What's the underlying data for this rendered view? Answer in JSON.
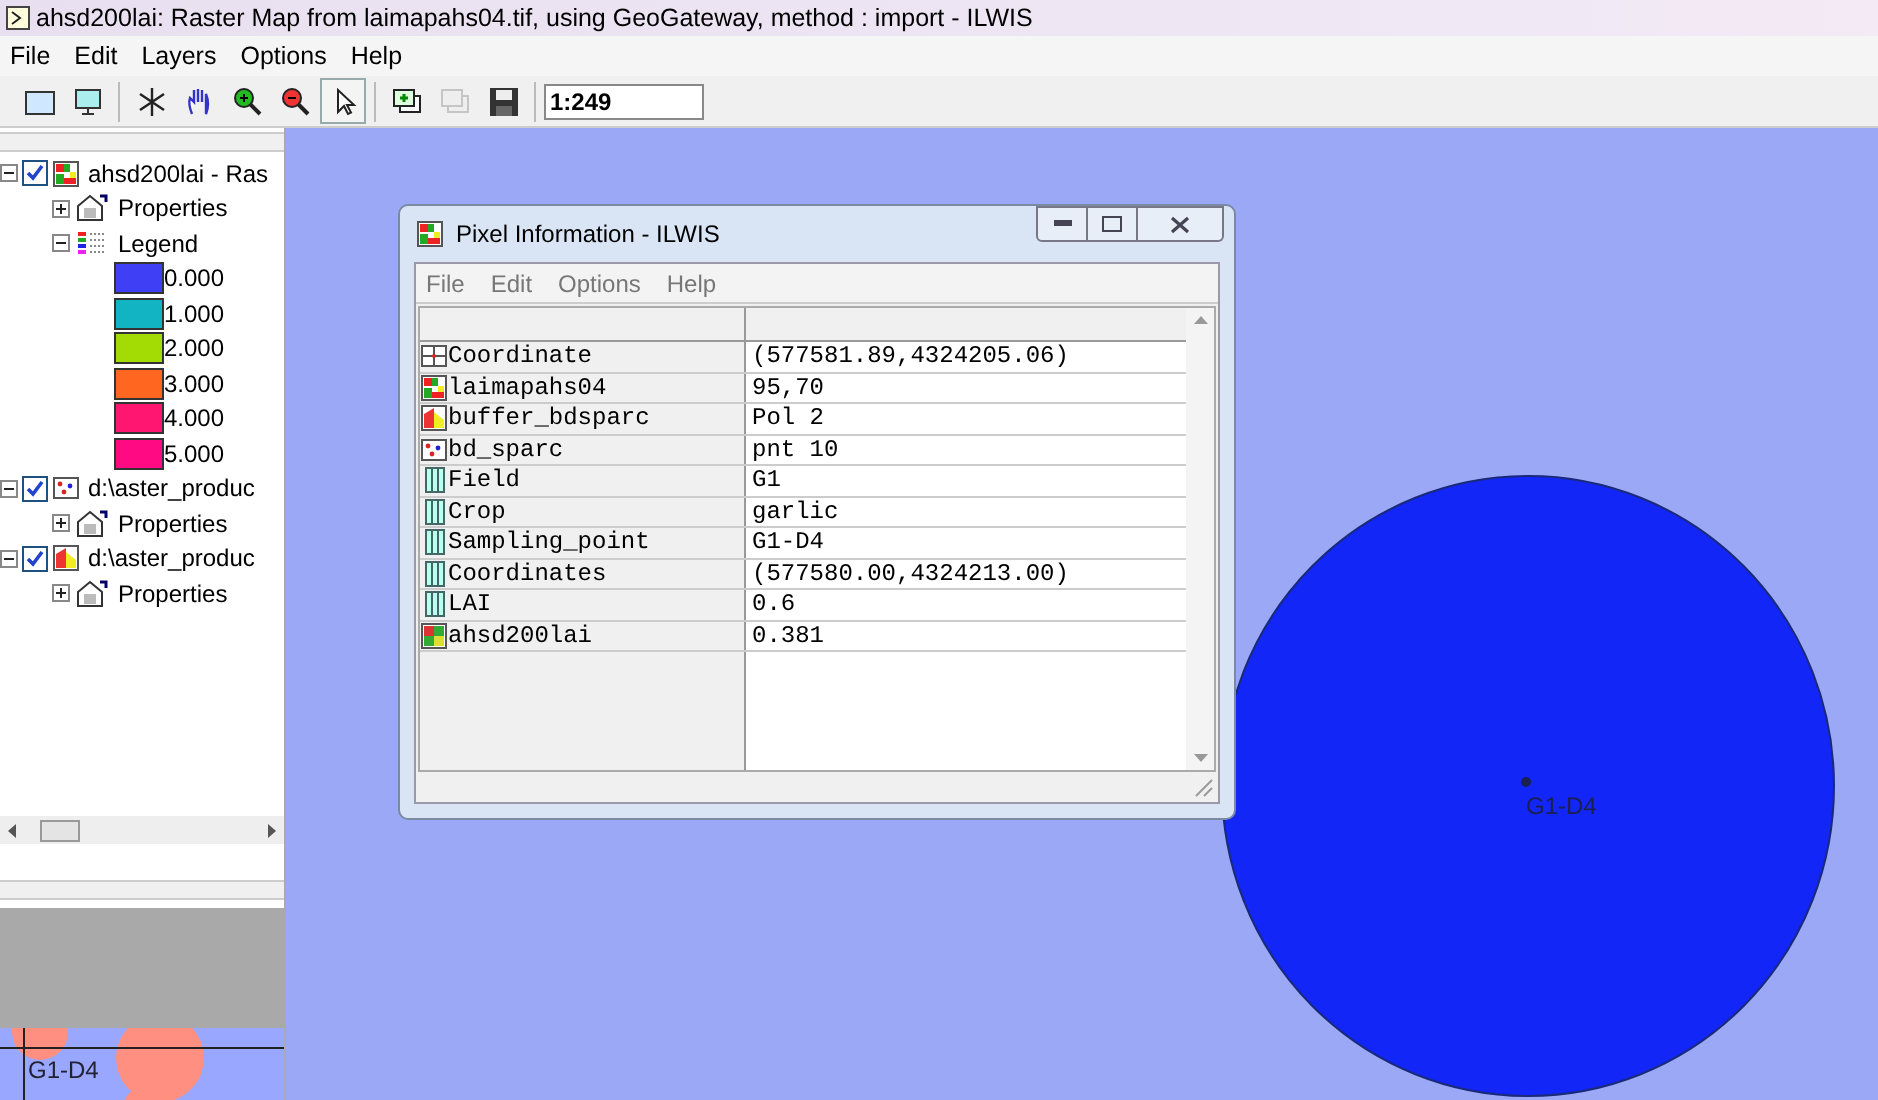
{
  "window": {
    "title": "ahsd200lai: Raster Map from laimapahs04.tif, using GeoGateway, method : import - ILWIS"
  },
  "menu": [
    "File",
    "Edit",
    "Layers",
    "Options",
    "Help"
  ],
  "toolbar": {
    "buttons": [
      {
        "kind": "new-map",
        "selected": false,
        "disabled": false
      },
      {
        "kind": "screen",
        "selected": false,
        "disabled": false
      },
      {
        "kind": "sep"
      },
      {
        "kind": "star",
        "selected": false,
        "disabled": false
      },
      {
        "kind": "hand",
        "selected": false,
        "disabled": false
      },
      {
        "kind": "zoom-in",
        "selected": false,
        "disabled": false
      },
      {
        "kind": "zoom-out",
        "selected": false,
        "disabled": false
      },
      {
        "kind": "pointer",
        "selected": true,
        "disabled": false
      },
      {
        "kind": "sep"
      },
      {
        "kind": "add-layer",
        "selected": false,
        "disabled": false
      },
      {
        "kind": "remove-layer",
        "selected": false,
        "disabled": true
      },
      {
        "kind": "save",
        "selected": false,
        "disabled": false
      }
    ],
    "scale": "1:249"
  },
  "layers": [
    {
      "name": "ahsd200lai - Ras",
      "kind": "raster",
      "checked": true,
      "expanded": true,
      "properties": "Properties",
      "legend": {
        "label": "Legend",
        "expanded": true,
        "entries": [
          {
            "value": "0.000",
            "color": "#3f3ff5"
          },
          {
            "value": "1.000",
            "color": "#12b3c3"
          },
          {
            "value": "2.000",
            "color": "#a3dc04"
          },
          {
            "value": "3.000",
            "color": "#ff6620"
          },
          {
            "value": "4.000",
            "color": "#ff1670"
          },
          {
            "value": "5.000",
            "color": "#ff0a82"
          }
        ]
      }
    },
    {
      "name": "d:\\aster_produc",
      "kind": "point",
      "checked": true,
      "expanded": true,
      "properties": "Properties"
    },
    {
      "name": "d:\\aster_produc",
      "kind": "polygon",
      "checked": true,
      "expanded": true,
      "properties": "Properties"
    }
  ],
  "map": {
    "label": "G1-D4"
  },
  "overview": {
    "label": "G1-D4"
  },
  "pixel_info": {
    "title": "Pixel Information - ILWIS",
    "menu": [
      "File",
      "Edit",
      "Options",
      "Help"
    ],
    "rows": [
      {
        "kind": "coordinate",
        "name": "Coordinate",
        "value": "(577581.89,4324205.06)"
      },
      {
        "kind": "raster",
        "name": "laimapahs04",
        "value": "95,70"
      },
      {
        "kind": "polygon",
        "name": "buffer_bdsparc",
        "value": "Pol 2"
      },
      {
        "kind": "point",
        "name": "bd_sparc",
        "value": "pnt 10"
      },
      {
        "kind": "column",
        "name": "Field",
        "value": "G1"
      },
      {
        "kind": "column",
        "name": "Crop",
        "value": "garlic"
      },
      {
        "kind": "column",
        "name": "Sampling_point",
        "value": "G1-D4"
      },
      {
        "kind": "column",
        "name": "Coordinates",
        "value": "(577580.00,4324213.00)"
      },
      {
        "kind": "column",
        "name": "LAI",
        "value": "0.6"
      },
      {
        "kind": "grid",
        "name": "ahsd200lai",
        "value": "0.381"
      }
    ]
  }
}
